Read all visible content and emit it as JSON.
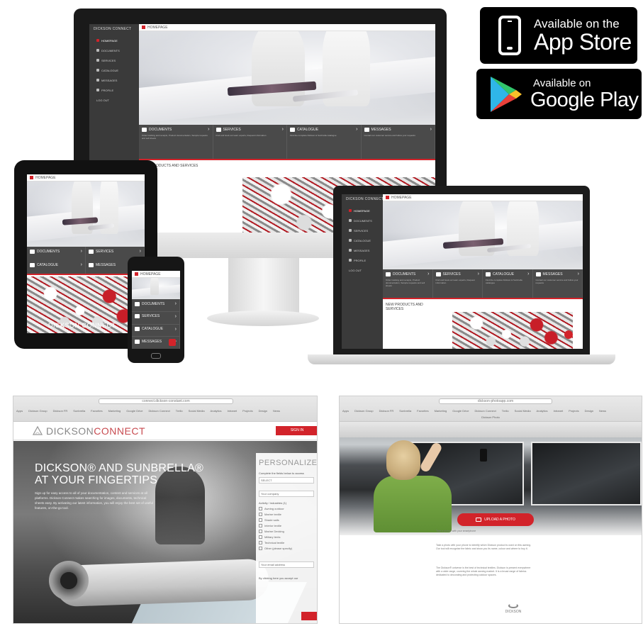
{
  "stores": {
    "appstore": {
      "line1": "Available on the",
      "line2": "App Store"
    },
    "googleplay": {
      "line1": "Available on",
      "line2": "Google Play"
    }
  },
  "app": {
    "brand": "DICKSON CONNECT",
    "topbar_title": "HOMEPAGE",
    "nav": [
      "HOMEPAGE",
      "DOCUMENTS",
      "SERVICES",
      "CATALOGUE",
      "MESSAGES",
      "PROFILE",
      "LOG OUT"
    ],
    "tiles": [
      {
        "label": "DOCUMENTS",
        "desc": "Order tracking and receipts, Product documentation, Sample requests and sell sheets"
      },
      {
        "label": "SERVICES",
        "desc": "Find and book our team experts, Request information"
      },
      {
        "label": "CATALOGUE",
        "desc": "Find the complete Dickson & Sunbrella catalogue"
      },
      {
        "label": "MESSAGES",
        "desc": "Contact our customer service and follow your requests"
      }
    ],
    "products_title": "NEW PRODUCTS AND SERVICES"
  },
  "signup_page": {
    "url": "connect.dickson-constant.com",
    "bookmarks": [
      "Apps",
      "Dickson Group",
      "Dickson FR",
      "Sunbrella",
      "Favorites",
      "Marketing",
      "Google Drive",
      "Dickson Connect",
      "Trello",
      "Social Media",
      "Analytics",
      "Intranet",
      "Projects",
      "Design",
      "News"
    ],
    "logo_dickson": "DICKSON",
    "logo_connect": "CONNECT",
    "signin_label": "SIGN IN",
    "hero_title": "DICKSON® AND SUNBRELLA® AT YOUR FINGERTIPS",
    "hero_text": "Sign up for easy access to all of your documentation, content and services at all platforms. Dickson Connect makes searching for images, documents, technical sheets easy. By activating our latest information, you will enjoy the best set of useful features, on-the-go tool.",
    "form_title": "PERSONALIZED CO",
    "form_intro": "Complete the fields below to access",
    "field_country": "SELECT",
    "field_company": "Your company",
    "section_label": "Activity / industries (1)",
    "checkboxes": [
      "Awning outdoor",
      "Marine textile",
      "Shade sails",
      "Interior textile",
      "Marine Decking",
      "Military tents",
      "Technical textile",
      "Other (please specify)"
    ],
    "field_email": "Your email address",
    "consent": "By clicking here you accept our"
  },
  "upload_page": {
    "url": "dickson-photoapp.com",
    "subline": "Dickson Photo",
    "button": "UPLOAD A PHOTO",
    "link_line": "Take a picture with your smartphone",
    "para1": "Take a photo with your phone to identify which Dickson product is used on this awning. Our tool will recognise the fabric and show you its name, colour and where to buy it.",
    "para2": "The Dickson® universe is the best of technical textiles. Dickson is present everywhere with a wide range, covering the whole awning market. It is a broad range of fabrics dedicated to decorating and protecting outdoor spaces.",
    "logo": "DICKSON"
  }
}
